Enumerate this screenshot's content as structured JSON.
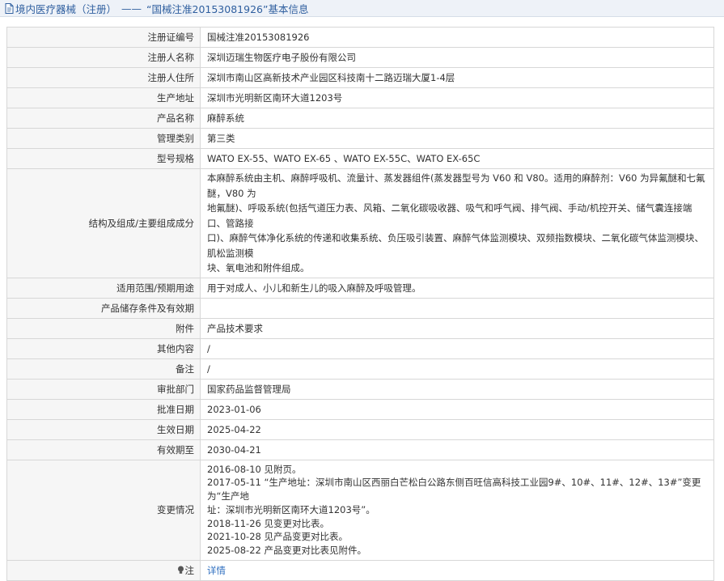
{
  "header": {
    "title_prefix": "境内医疗器械（注册）",
    "separator": "——",
    "title_main": "“国械注准20153081926”基本信息",
    "accent_color": "#2f5f9f"
  },
  "rows": [
    {
      "label": "注册证编号",
      "value": "国械注准20153081926"
    },
    {
      "label": "注册人名称",
      "value": "深圳迈瑞生物医疗电子股份有限公司"
    },
    {
      "label": "注册人住所",
      "value": "深圳市南山区高新技术产业园区科技南十二路迈瑞大厦1-4层"
    },
    {
      "label": "生产地址",
      "value": "深圳市光明新区南环大道1203号"
    },
    {
      "label": "产品名称",
      "value": "麻醉系统"
    },
    {
      "label": "管理类别",
      "value": "第三类"
    },
    {
      "label": "型号规格",
      "value": "WATO EX-55、WATO EX-65 、WATO EX-55C、WATO EX-65C"
    },
    {
      "label": "结构及组成/主要组成成分",
      "lines": [
        "本麻醉系统由主机、麻醉呼吸机、流量计、蒸发器组件(蒸发器型号为 V60 和 V80。适用的麻醉剂：V60 为异氟醚和七氟醚，V80 为",
        "地氟醚)、呼吸系统(包括气道压力表、风箱、二氧化碳吸收器、吸气和呼气阀、排气阀、手动/机控开关、储气囊连接端口、管路接",
        "口)、麻醉气体净化系统的传递和收集系统、负压吸引装置、麻醉气体监测模块、双频指数模块、二氧化碳气体监测模块、肌松监测模",
        "块、氧电池和附件组成。"
      ]
    },
    {
      "label": "适用范围/预期用途",
      "value": "用于对成人、小儿和新生儿的吸入麻醉及呼吸管理。"
    },
    {
      "label": "产品储存条件及有效期",
      "value": ""
    },
    {
      "label": "附件",
      "value": "产品技术要求"
    },
    {
      "label": "其他内容",
      "value": "/"
    },
    {
      "label": "备注",
      "value": "/"
    },
    {
      "label": "审批部门",
      "value": "国家药品监督管理局"
    },
    {
      "label": "批准日期",
      "value": "2023-01-06"
    },
    {
      "label": "生效日期",
      "value": "2025-04-22"
    },
    {
      "label": "有效期至",
      "value": "2030-04-21"
    },
    {
      "label": "变更情况",
      "lines": [
        "2016-08-10 见附页。",
        "2017-05-11 “生产地址：深圳市南山区西丽白芒松白公路东侧百旺信高科技工业园9#、10#、11#、12#、13#”变更为“生产地",
        "址：深圳市光明新区南环大道1203号”。",
        "2018-11-26 见变更对比表。",
        "2021-10-28 见产品变更对比表。",
        "2025-08-22 产品变更对比表见附件。"
      ]
    },
    {
      "label": "注",
      "value": "详情",
      "icon": "lightbulb-icon"
    }
  ]
}
